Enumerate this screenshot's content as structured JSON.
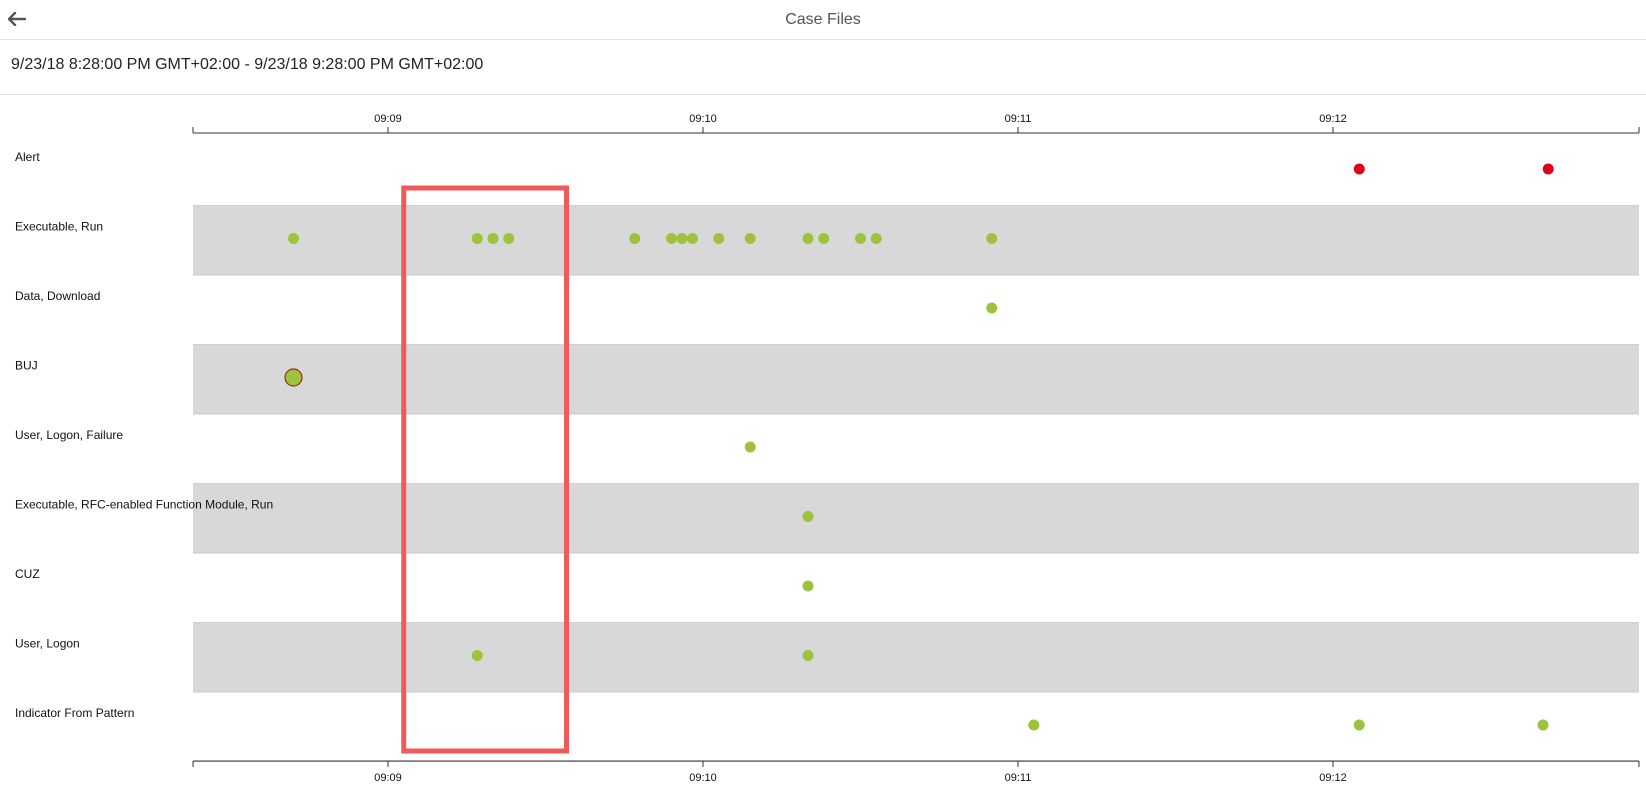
{
  "header": {
    "title": "Case Files",
    "back_icon": "arrow-left-icon"
  },
  "range_text": "9/23/18 8:28:00 PM GMT+02:00 - 9/23/18 9:28:00 PM GMT+02:00",
  "colors": {
    "event": "#9dc33c",
    "alert": "#e0001b",
    "band": "#d8d8d8",
    "highlight": "#f05a5a",
    "bubble_outline": "#a0262b"
  },
  "timeline": {
    "tick_labels": [
      "09:09",
      "09:10",
      "09:11",
      "09:12"
    ],
    "highlight": {
      "start": "09:09:03",
      "end": "09:09:34"
    },
    "rows": [
      {
        "label": "Alert",
        "events": [
          {
            "t": "09:12:05",
            "kind": "alert"
          },
          {
            "t": "09:12:41",
            "kind": "alert"
          }
        ]
      },
      {
        "label": "Executable, Run",
        "events": [
          {
            "t": "09:08:42"
          },
          {
            "t": "09:09:17"
          },
          {
            "t": "09:09:20"
          },
          {
            "t": "09:09:23"
          },
          {
            "t": "09:09:47"
          },
          {
            "t": "09:09:54"
          },
          {
            "t": "09:09:56"
          },
          {
            "t": "09:09:58"
          },
          {
            "t": "09:10:03"
          },
          {
            "t": "09:10:09"
          },
          {
            "t": "09:10:20"
          },
          {
            "t": "09:10:23"
          },
          {
            "t": "09:10:30"
          },
          {
            "t": "09:10:33"
          },
          {
            "t": "09:10:55"
          }
        ]
      },
      {
        "label": "Data, Download",
        "events": [
          {
            "t": "09:10:55"
          }
        ]
      },
      {
        "label": "BUJ",
        "events": [
          {
            "t": "09:08:42",
            "kind": "bubble"
          }
        ]
      },
      {
        "label": "User, Logon, Failure",
        "events": [
          {
            "t": "09:10:09"
          }
        ]
      },
      {
        "label": "Executable, RFC-enabled Function Module, Run",
        "events": [
          {
            "t": "09:10:20"
          }
        ]
      },
      {
        "label": "CUZ",
        "events": [
          {
            "t": "09:10:20"
          }
        ]
      },
      {
        "label": "User, Logon",
        "events": [
          {
            "t": "09:09:17"
          },
          {
            "t": "09:10:20"
          }
        ]
      },
      {
        "label": "Indicator From Pattern",
        "events": [
          {
            "t": "09:11:03"
          },
          {
            "t": "09:12:05"
          },
          {
            "t": "09:12:40"
          }
        ]
      }
    ]
  }
}
